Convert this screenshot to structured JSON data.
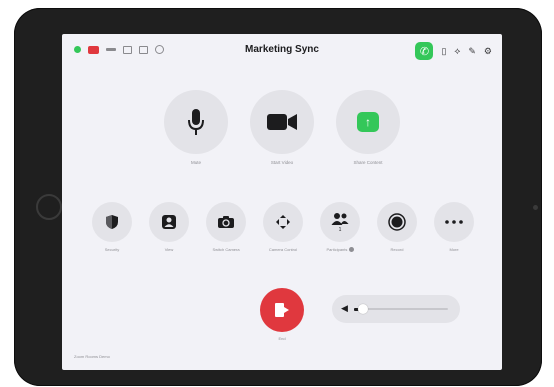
{
  "header": {
    "title": "Marketing Sync"
  },
  "icons": {
    "left": [
      "status-dot",
      "camera-icon",
      "signal-icon",
      "document-icon",
      "list-icon",
      "settings-circle-icon"
    ],
    "right": [
      "phone-icon",
      "device-icon",
      "connection-icon",
      "edit-icon",
      "gear-icon"
    ]
  },
  "main_controls": [
    {
      "label": "Mute",
      "icon": "microphone-icon"
    },
    {
      "label": "Start Video",
      "icon": "video-camera-icon"
    },
    {
      "label": "Share Content",
      "icon": "share-screen-icon"
    }
  ],
  "secondary_controls": [
    {
      "label": "Security",
      "icon": "shield-icon"
    },
    {
      "label": "View",
      "icon": "view-icon"
    },
    {
      "label": "Switch Camera",
      "icon": "switch-camera-icon"
    },
    {
      "label": "Camera Control",
      "icon": "camera-control-icon"
    },
    {
      "label": "Participants",
      "icon": "participants-icon",
      "count": "1"
    },
    {
      "label": "Record",
      "icon": "record-icon"
    },
    {
      "label": "More",
      "icon": "more-icon"
    }
  ],
  "end": {
    "label": "End"
  },
  "volume": {
    "level": 0.1
  },
  "footer": {
    "text": "Zoom Rooms Demo"
  },
  "colors": {
    "accent_green": "#34c759",
    "end_red": "#e0383e",
    "button_bg": "#e3e3e8"
  }
}
